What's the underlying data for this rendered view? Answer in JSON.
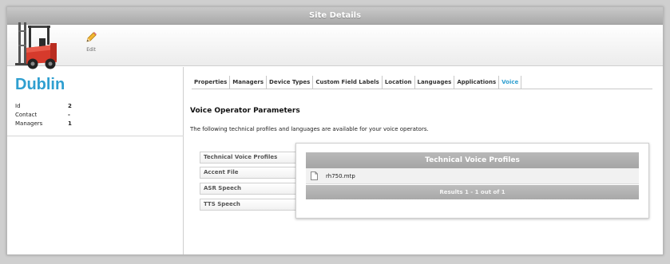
{
  "window": {
    "title": "Site Details"
  },
  "toolbar": {
    "edit_label": "Edit",
    "edit_icon": "pencil-icon",
    "logo_icon": "forklift-icon"
  },
  "site": {
    "name": "Dublin",
    "info": [
      {
        "label": "Id",
        "value": "2"
      },
      {
        "label": "Contact",
        "value": "-"
      },
      {
        "label": "Managers",
        "value": "1"
      }
    ]
  },
  "tabs": [
    {
      "label": "Properties",
      "active": false
    },
    {
      "label": "Managers",
      "active": false
    },
    {
      "label": "Device Types",
      "active": false
    },
    {
      "label": "Custom Field Labels",
      "active": false
    },
    {
      "label": "Location",
      "active": false
    },
    {
      "label": "Languages",
      "active": false
    },
    {
      "label": "Applications",
      "active": false
    },
    {
      "label": "Voice",
      "active": true
    }
  ],
  "voice": {
    "title": "Voice Operator Parameters",
    "description": "The following technical profiles and languages are available for your voice operators.",
    "accordion": [
      "Technical Voice Profiles",
      "Accent File",
      "ASR Speech",
      "TTS Speech"
    ]
  },
  "popup": {
    "header": "Technical Voice Profiles",
    "rows": [
      {
        "file": "rh750.mtp",
        "icon": "file-icon"
      }
    ],
    "footer": "Results 1 - 1 out of 1"
  },
  "colors": {
    "accent": "#2f9fd0",
    "titlebar": "#b3b3b3",
    "background": "#cfcfcf"
  }
}
